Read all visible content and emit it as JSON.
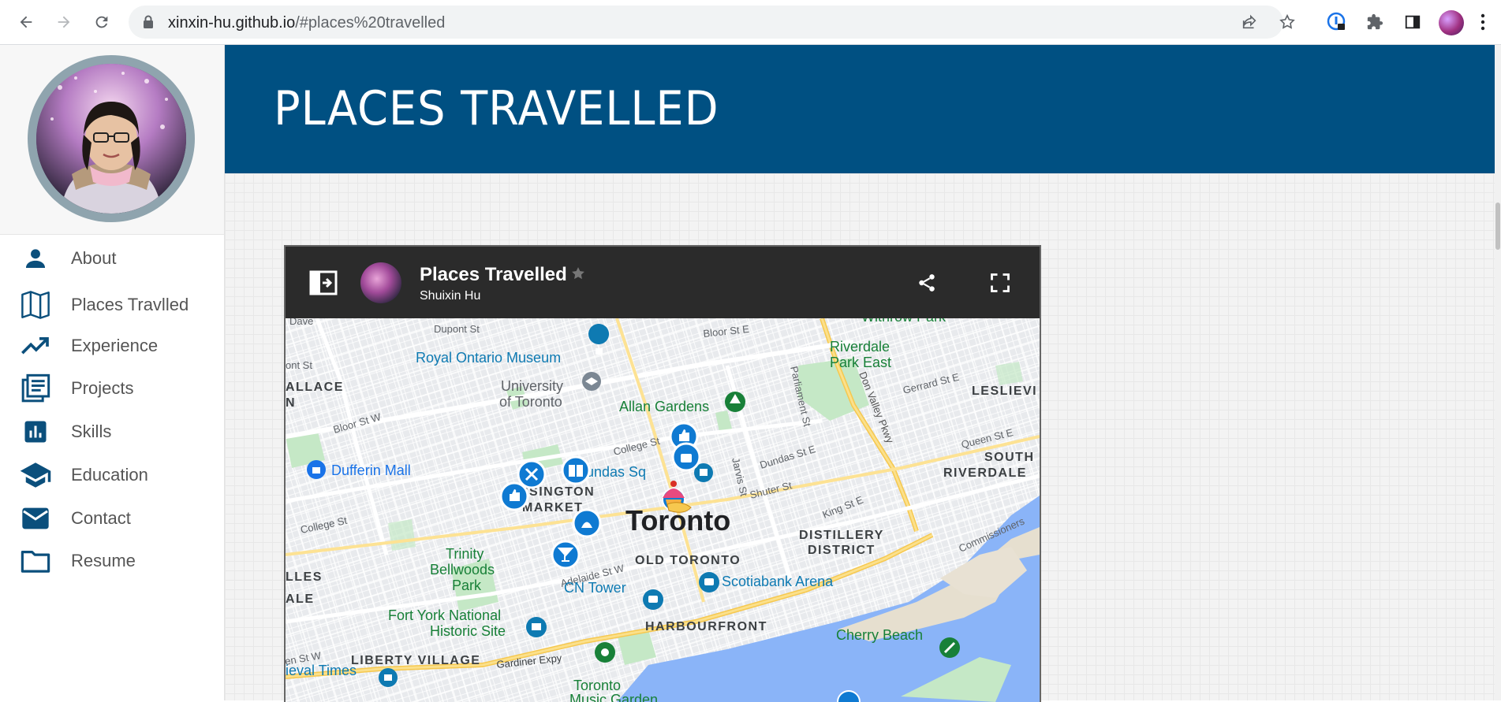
{
  "browser": {
    "url_host": "xinxin-hu.github.io",
    "url_path": "/#places%20travelled"
  },
  "sidebar": {
    "items": [
      {
        "label": "About",
        "icon": "person-icon"
      },
      {
        "label": "Places Travlled",
        "icon": "map-icon"
      },
      {
        "label": "Experience",
        "icon": "trending-up-icon"
      },
      {
        "label": "Projects",
        "icon": "article-icon"
      },
      {
        "label": "Skills",
        "icon": "bar-chart-icon"
      },
      {
        "label": "Education",
        "icon": "school-icon"
      },
      {
        "label": "Contact",
        "icon": "mail-icon"
      },
      {
        "label": "Resume",
        "icon": "folder-icon"
      }
    ]
  },
  "page": {
    "title": "PLACES TRAVELLED"
  },
  "map": {
    "title": "Places Travelled",
    "author": "Shuixin Hu",
    "labels": {
      "dupont": "Dupont St",
      "davenport": "Dave",
      "bloor_e": "Bloor St E",
      "withrow": "Withrow Park",
      "riverdale": "Riverdale",
      "riverdale2": "Park East",
      "rom": "Royal Ontario Museum",
      "uoft1": "University",
      "uoft2": "of Toronto",
      "allan": "Allan Gardens",
      "parliament": "Parliament St",
      "donvalley": "Don Valley Pkwy",
      "gerrard": "Gerrard St E",
      "leslieville": "LESLIEVI",
      "wallace1": "ALLACE",
      "wallace2": "N",
      "bloor_w": "Bloor St W",
      "college": "College St",
      "dundas_sq": "Dundas Sq",
      "dundas_e": "Dundas St E",
      "jarvis": "Jarvis St",
      "queen_e": "Queen St E",
      "south_riv1": "SOUTH",
      "south_riv2": "RIVERDALE",
      "dufferin": "Dufferin Mall",
      "kensington1": "NSINGTON",
      "kensington2": "MARKET",
      "shuter": "Shuter St",
      "toronto": "Toronto",
      "king_e": "King St E",
      "distillery1": "DISTILLERY",
      "distillery2": "DISTRICT",
      "commissioners": "Commissioners",
      "college_w": "College St",
      "trinity1": "Trinity",
      "trinity2": "Bellwoods",
      "trinity3": "Park",
      "old_toronto": "OLD TORONTO",
      "adelaide": "Adelaide St W",
      "cn_tower": "CN Tower",
      "scotiabank": "Scotiabank Arena",
      "lles": "LLES",
      "ale": "ALE",
      "fort_york1": "Fort York National",
      "fort_york2": "Historic Site",
      "harbourfront": "HARBOURFRONT",
      "cherry": "Cherry Beach",
      "liberty": "LIBERTY VILLAGE",
      "gardiner": "Gardiner Expy",
      "toronto_music1": "Toronto",
      "toronto_music2": "Music Garden",
      "medieval": "ieval Times",
      "st_w": "en St W",
      "ont_st": "ont St"
    }
  },
  "colors": {
    "banner": "#005082",
    "nav_icon": "#0b4f7c",
    "map_header": "#2b2b2b",
    "marker": "#0f7ad2"
  }
}
